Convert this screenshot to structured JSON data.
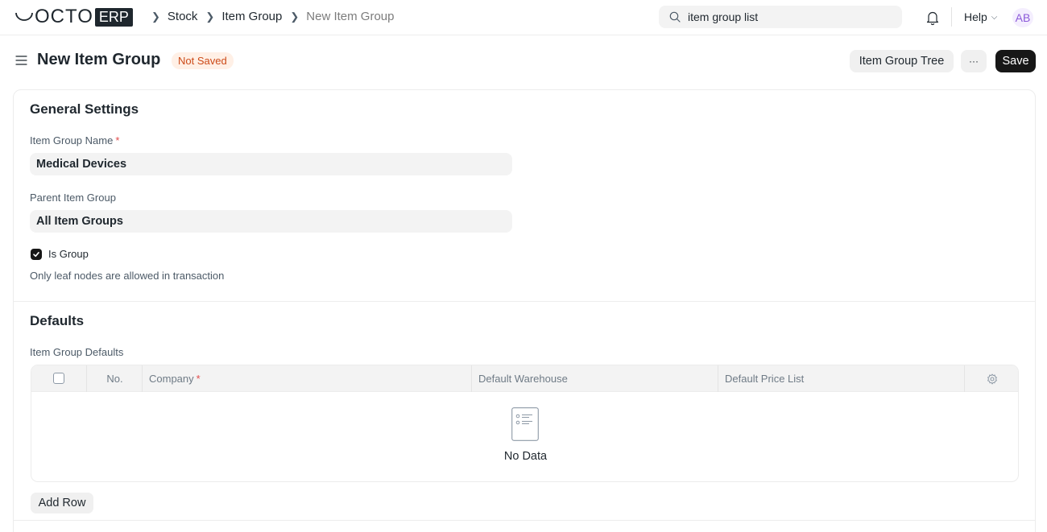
{
  "navbar": {
    "logo_text": "OCTO",
    "logo_badge": "ERP",
    "breadcrumbs": [
      "Stock",
      "Item Group",
      "New Item Group"
    ],
    "search": {
      "value": "item group list",
      "icon": "search-icon"
    },
    "notifications_icon": "bell-icon",
    "help_label": "Help",
    "avatar_initials": "AB"
  },
  "page": {
    "title": "New Item Group",
    "status": "Not Saved",
    "actions": {
      "tree_label": "Item Group Tree",
      "more_label": "···",
      "save_label": "Save"
    }
  },
  "general_settings": {
    "title": "General Settings",
    "item_group_name": {
      "label": "Item Group Name",
      "required_mark": "*",
      "value": "Medical Devices"
    },
    "parent_item_group": {
      "label": "Parent Item Group",
      "value": "All Item Groups"
    },
    "is_group": {
      "label": "Is Group",
      "checked": true
    },
    "help_text": "Only leaf nodes are allowed in transaction"
  },
  "defaults": {
    "title": "Defaults",
    "table_label": "Item Group Defaults",
    "columns": {
      "no": "No.",
      "company": "Company",
      "company_required": "*",
      "warehouse": "Default Warehouse",
      "price_list": "Default Price List"
    },
    "rows": [],
    "empty_text": "No Data",
    "add_row_label": "Add Row"
  },
  "colors": {
    "primary_button": "#171717",
    "status_text": "#cc4a18",
    "status_bg": "#fff0e6",
    "avatar_text": "#8c5ad9",
    "avatar_bg": "#f4eefe"
  }
}
